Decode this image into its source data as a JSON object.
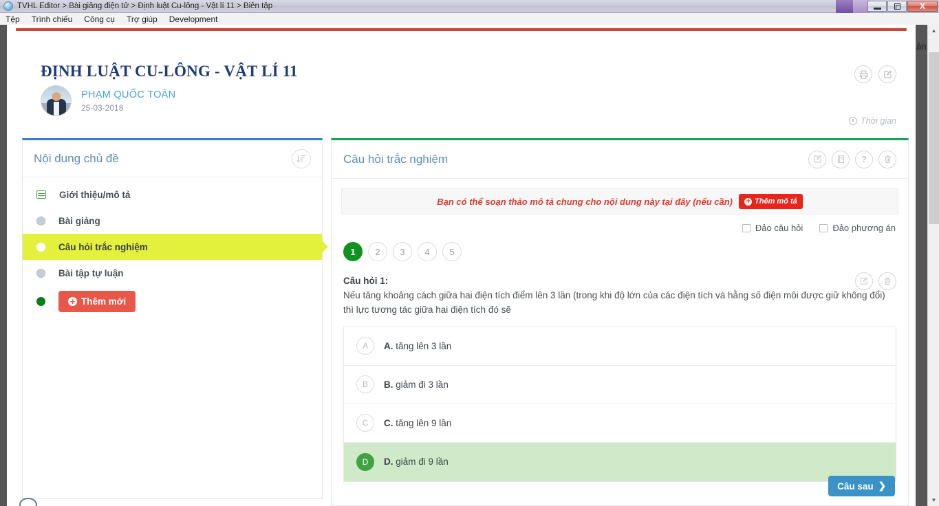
{
  "window": {
    "app_icon": "app-globe-icon",
    "title": "TVHL Editor > Bài giảng điện tử > Định luật Cu-lông - Vật lí 11 > Biên tập",
    "buttons": {
      "minimize": "minimize",
      "maximize": "maximize",
      "close": "X"
    }
  },
  "menubar": {
    "items": [
      {
        "label": "Tệp"
      },
      {
        "label": "Trình chiếu"
      },
      {
        "label": "Công cụ"
      },
      {
        "label": "Trợ giúp"
      },
      {
        "label": "Development"
      }
    ]
  },
  "header": {
    "title": "ĐỊNH LUẬT CU-LÔNG - VẬT LÍ 11",
    "author": "PHẠM QUỐC TOÀN",
    "date": "25-03-2018",
    "time_label": "Thời gian",
    "actions": [
      {
        "name": "print-icon",
        "glyph": "print"
      },
      {
        "name": "edit-icon",
        "glyph": "edit"
      }
    ],
    "accent_bar_color": "#c9483e"
  },
  "sidebar": {
    "title": "Nội dung chủ đề",
    "sort_icon": "sort-list-icon",
    "accent_color": "#2f7ec1",
    "items": [
      {
        "label": "Giới thiệu/mô tả",
        "bullet": "doc",
        "active": false
      },
      {
        "label": "Bài giảng",
        "bullet": "grey",
        "active": false
      },
      {
        "label": "Câu hỏi trắc nghiệm",
        "bullet": "white",
        "active": true
      },
      {
        "label": "Bài tập tự luận",
        "bullet": "grey",
        "active": false
      }
    ],
    "add_button": "Thêm mới"
  },
  "main": {
    "title": "Câu hỏi trắc nghiệm",
    "accent_color": "#18a05a",
    "actions": [
      {
        "name": "edit-icon",
        "glyph": "edit"
      },
      {
        "name": "book-icon",
        "glyph": "book"
      },
      {
        "name": "help-icon",
        "glyph": "?"
      },
      {
        "name": "trash-icon",
        "glyph": "trash"
      }
    ],
    "description_bar": {
      "text": "Bạn có thể soạn thảo mô tả chung cho nội dung này tại đây (nếu cần)",
      "button": "Thêm mô tả"
    },
    "options": [
      {
        "label": "Đảo câu hỏi",
        "checked": false
      },
      {
        "label": "Đảo phương án",
        "checked": false
      }
    ],
    "pager": {
      "pages": [
        "1",
        "2",
        "3",
        "4",
        "5"
      ],
      "active_index": 0
    },
    "question": {
      "label": "Câu hỏi 1:",
      "text": "Nếu tăng khoảng cách giữa hai điện tích điểm lên 3 lần (trong khi độ lớn của các điện tích và hằng số điện môi được giữ không đổi) thì lực tương tác giữa hai điện tích đó sẽ",
      "actions": [
        {
          "name": "edit-icon",
          "glyph": "edit"
        },
        {
          "name": "trash-icon",
          "glyph": "trash"
        }
      ],
      "answers": [
        {
          "key": "A",
          "prefix": "A.",
          "text": " tăng lên 3 lần",
          "correct": false
        },
        {
          "key": "B",
          "prefix": "B.",
          "text": " giảm đi 3 lần",
          "correct": false
        },
        {
          "key": "C",
          "prefix": "C.",
          "text": " tăng lên 9 lần",
          "correct": false
        },
        {
          "key": "D",
          "prefix": "D.",
          "text": " giảm đi 9 lần",
          "correct": true
        }
      ]
    },
    "next_button": "Câu sau"
  },
  "right_strip": {
    "clipped_text": "ản"
  }
}
